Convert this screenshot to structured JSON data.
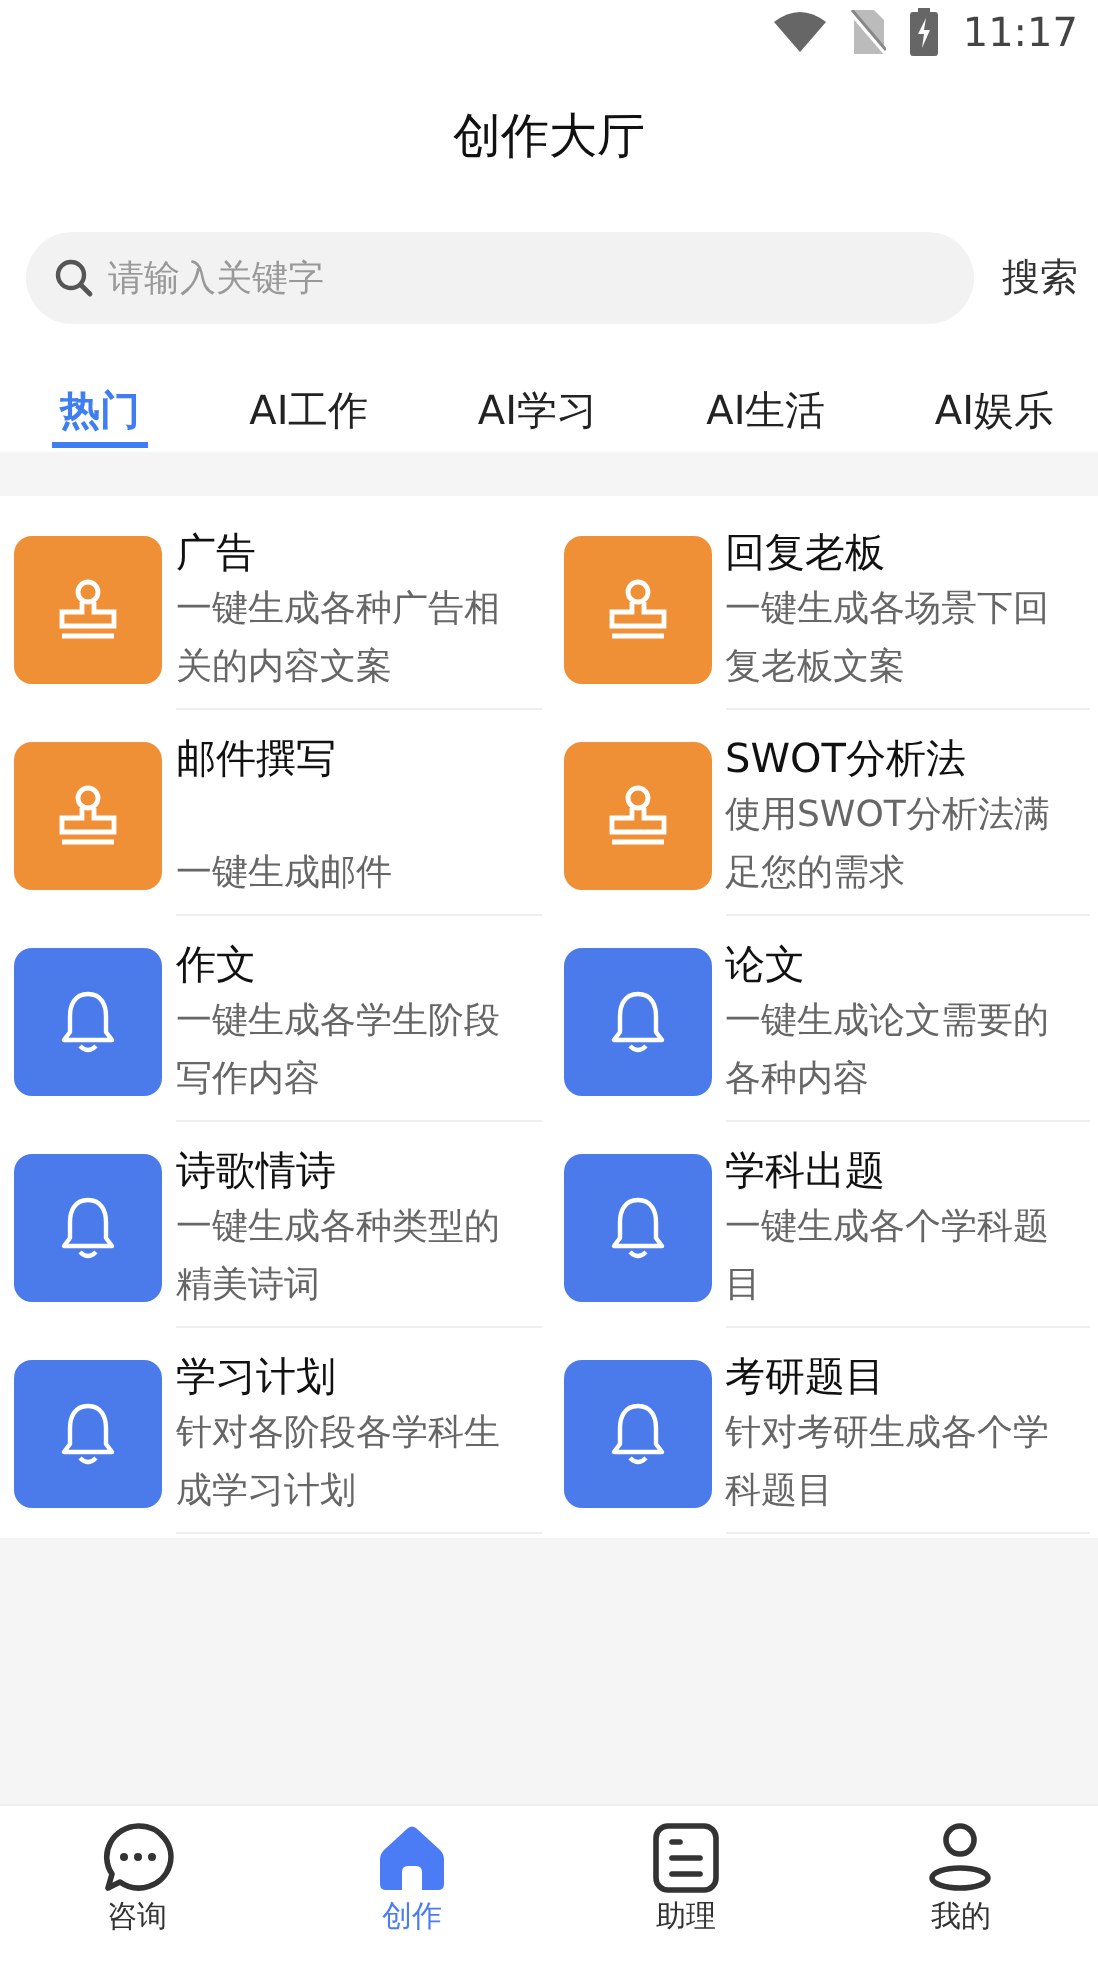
{
  "status_bar": {
    "time": "11:17"
  },
  "header": {
    "title": "创作大厅"
  },
  "search": {
    "placeholder": "请输入关键字",
    "button": "搜索"
  },
  "tabs": [
    {
      "label": "热门",
      "selected": true
    },
    {
      "label": "AI工作",
      "selected": false
    },
    {
      "label": "AI学习",
      "selected": false
    },
    {
      "label": "AI生活",
      "selected": false
    },
    {
      "label": "AI娱乐",
      "selected": false
    }
  ],
  "items": [
    {
      "kind": "stamp",
      "title": "广告",
      "description": "一键生成各种广告相关的内容文案"
    },
    {
      "kind": "stamp",
      "title": "回复老板",
      "description": "一键生成各场景下回复老板文案"
    },
    {
      "kind": "stamp",
      "title": "邮件撰写",
      "description": "一键生成邮件"
    },
    {
      "kind": "stamp",
      "title": "SWOT分析法",
      "description": "使用SWOT分析法满足您的需求"
    },
    {
      "kind": "bell",
      "title": "作文",
      "description": "一键生成各学生阶段写作内容"
    },
    {
      "kind": "bell",
      "title": "论文",
      "description": "一键生成论文需要的各种内容"
    },
    {
      "kind": "bell",
      "title": "诗歌情诗",
      "description": "一键生成各种类型的精美诗词"
    },
    {
      "kind": "bell",
      "title": "学科出题",
      "description": "一键生成各个学科题目"
    },
    {
      "kind": "bell",
      "title": "学习计划",
      "description": "针对各阶段各学科生成学习计划"
    },
    {
      "kind": "bell",
      "title": "考研题目",
      "description": "针对考研生成各个学科题目"
    }
  ],
  "bottom_nav": [
    {
      "kind": "chat",
      "label": "咨询",
      "selected": false
    },
    {
      "kind": "home",
      "label": "创作",
      "selected": true
    },
    {
      "kind": "list",
      "label": "助理",
      "selected": false
    },
    {
      "kind": "person",
      "label": "我的",
      "selected": false
    }
  ]
}
